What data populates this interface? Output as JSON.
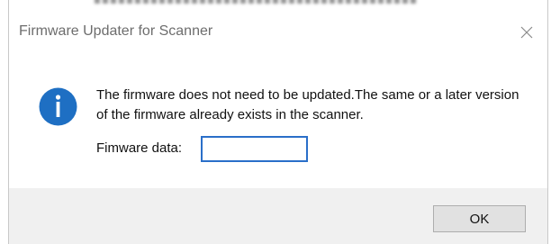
{
  "dialog": {
    "title": "Firmware Updater for Scanner",
    "message": "The firmware does not need to be updated.The same or a later version of the firmware already exists in the scanner.",
    "field_label": "Fimware data:",
    "field_value": "",
    "ok_label": "OK",
    "icon": "info-icon",
    "colors": {
      "icon_blue": "#1e6fc3",
      "input_border": "#2a6fc9",
      "footer_bg": "#f0f0f0"
    }
  }
}
